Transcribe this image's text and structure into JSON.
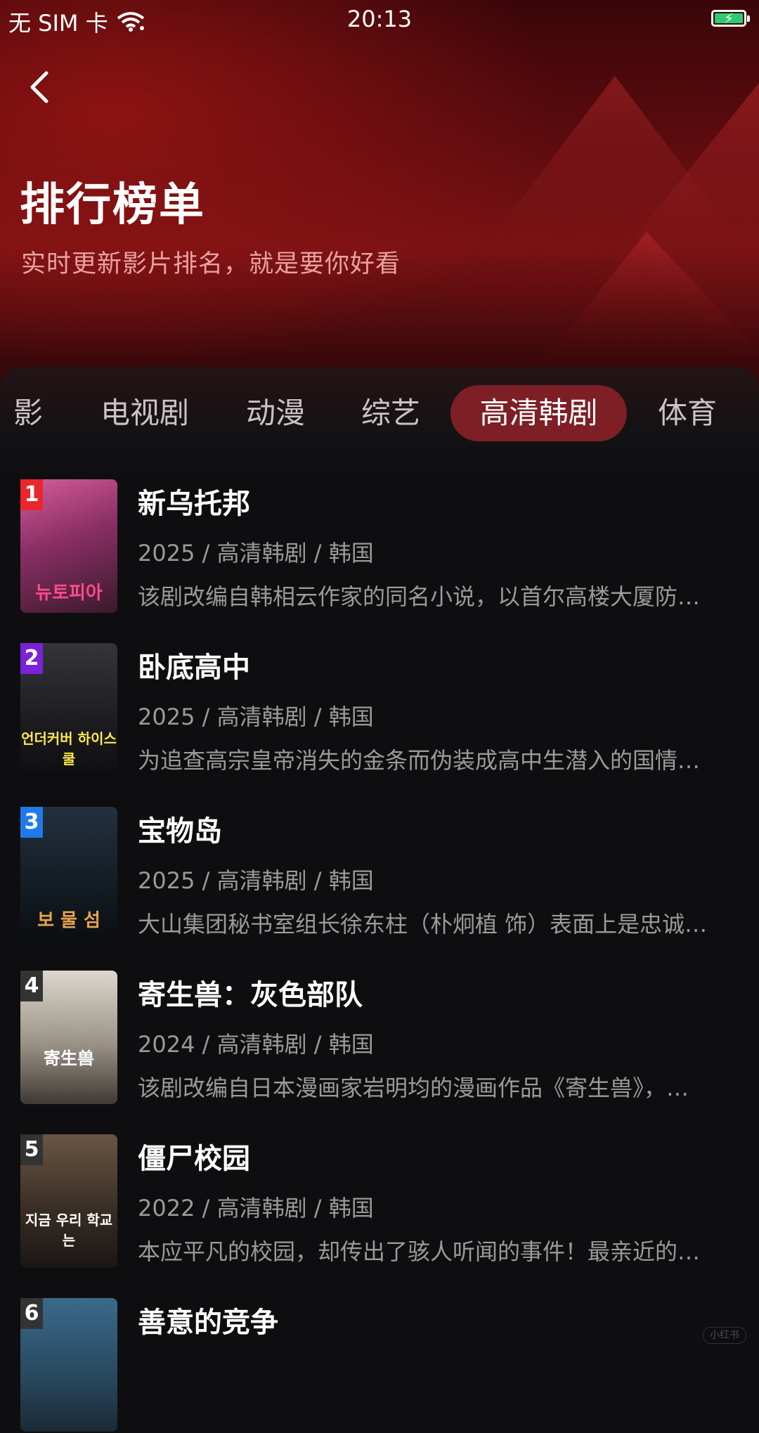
{
  "status_bar": {
    "carrier": "无 SIM 卡",
    "time": "20:13"
  },
  "header": {
    "title": "排行榜单",
    "subtitle": "实时更新影片排名，就是要你好看"
  },
  "tabs": [
    {
      "label": "影",
      "active": false
    },
    {
      "label": "电视剧",
      "active": false
    },
    {
      "label": "动漫",
      "active": false
    },
    {
      "label": "综艺",
      "active": false
    },
    {
      "label": "高清韩剧",
      "active": true
    },
    {
      "label": "体育",
      "active": false
    }
  ],
  "list": [
    {
      "rank": "1",
      "rank_color": "#e8262c",
      "title": "新乌托邦",
      "meta": "2025 / 高清韩剧 / 韩国",
      "desc": "该剧改编自韩相云作家的同名小说，以首尔高楼大厦防…",
      "poster_text": "뉴토피아",
      "poster_colors": [
        "#c04a86",
        "#7a2a5a",
        "#3a1a2a"
      ]
    },
    {
      "rank": "2",
      "rank_color": "#7a22d8",
      "title": "卧底高中",
      "meta": "2025 / 高清韩剧 / 韩国",
      "desc": "为追查高宗皇帝消失的金条而伪装成高中生潜入的国情…",
      "poster_text": "언더커버 하이스쿨",
      "poster_colors": [
        "#2a2a2e",
        "#18181a",
        "#0e0e10"
      ]
    },
    {
      "rank": "3",
      "rank_color": "#1e7ae8",
      "title": "宝物岛",
      "meta": "2025 / 高清韩剧 / 韩国",
      "desc": "大山集团秘书室组长徐东柱（朴炯植 饰）表面上是忠诚…",
      "poster_text": "보 물 섬",
      "poster_colors": [
        "#1c2a38",
        "#121a22",
        "#0a0e12"
      ]
    },
    {
      "rank": "4",
      "rank_color": "#333333",
      "title": "寄生兽：灰色部队",
      "meta": "2024 / 高清韩剧 / 韩国",
      "desc": "该剧改编自日本漫画家岩明均的漫画作品《寄生兽》，…",
      "poster_text": "寄生兽",
      "poster_colors": [
        "#d6d2c8",
        "#8c8478",
        "#3e3a34"
      ]
    },
    {
      "rank": "5",
      "rank_color": "#333333",
      "title": "僵尸校园",
      "meta": "2022 / 高清韩剧 / 韩国",
      "desc": "本应平凡的校园，却传出了骇人听闻的事件！最亲近的…",
      "poster_text": "지금 우리 학교는",
      "poster_colors": [
        "#5a4a3a",
        "#3a2e26",
        "#1a1614"
      ]
    },
    {
      "rank": "6",
      "rank_color": "#333333",
      "title": "善意的竞争",
      "meta": "",
      "desc": "",
      "poster_text": "",
      "poster_colors": [
        "#3a6a8a",
        "#2a4a62",
        "#1a2a36"
      ]
    }
  ],
  "watermark": "小红书"
}
